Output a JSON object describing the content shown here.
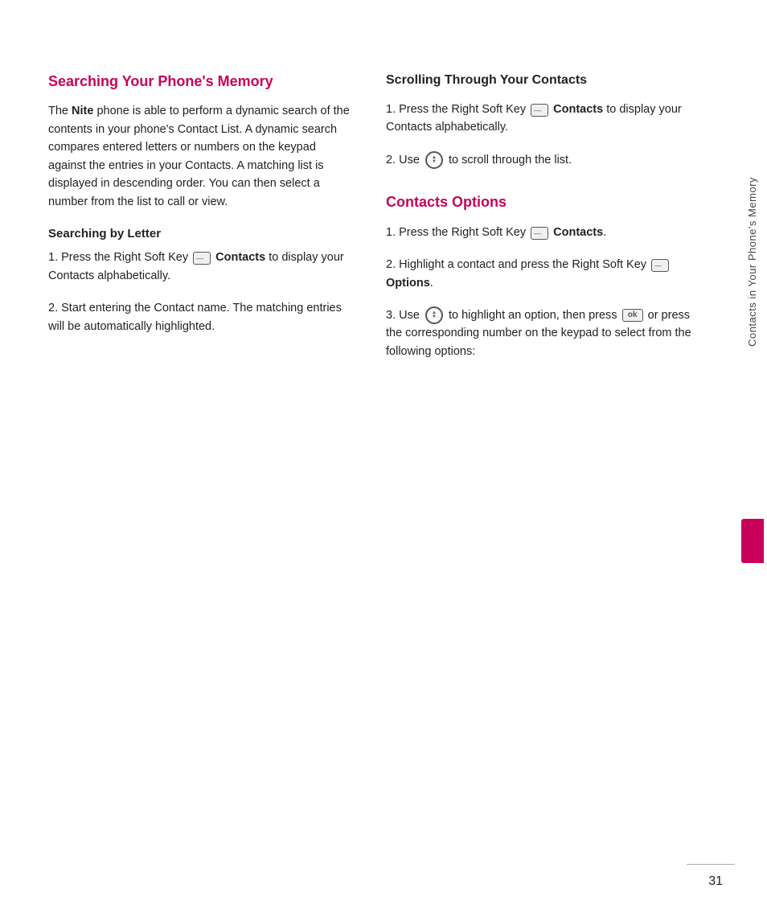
{
  "left_column": {
    "title": "Searching Your Phone's Memory",
    "intro": "The Nite phone is able to perform a dynamic search of the contents in your phone's Contact List. A dynamic search compares entered letters or numbers on the keypad against the entries in your Contacts. A matching list is displayed in descending order. You can then select a number from the list to call or view.",
    "intro_bold_word": "Nite",
    "sub_heading": "Searching by Letter",
    "items": [
      {
        "number": "1.",
        "text_before": "Press the Right Soft Key",
        "bold_word": "Contacts",
        "text_after": "to display your Contacts alphabetically.",
        "has_softkey_icon": true
      },
      {
        "number": "2.",
        "text": "Start entering the Contact name. The matching entries will be automatically highlighted."
      }
    ]
  },
  "right_column": {
    "scroll_section": {
      "title": "Scrolling Through Your Contacts",
      "items": [
        {
          "number": "1.",
          "text_before": "Press the Right Soft Key",
          "bold_word": "Contacts",
          "text_after": "to display your Contacts alphabetically.",
          "has_softkey_icon": true
        },
        {
          "number": "2.",
          "text_before": "Use",
          "text_after": "to scroll through the list.",
          "has_nav_icon": true
        }
      ]
    },
    "options_section": {
      "title": "Contacts Options",
      "items": [
        {
          "number": "1.",
          "text_before": "Press the Right Soft Key",
          "bold_word": "Contacts",
          "text_after": ".",
          "has_softkey_icon": true
        },
        {
          "number": "2.",
          "text_before": "Highlight a contact and press the Right Soft Key",
          "bold_word": "Options",
          "text_after": ".",
          "has_softkey_icon": true
        },
        {
          "number": "3.",
          "text_before": "Use",
          "text_middle1": "to highlight an option, then press",
          "text_middle2": "or press the corresponding number on the keypad to select from the following options:",
          "has_nav_icon": true,
          "has_ok_icon": true
        }
      ]
    }
  },
  "sidebar": {
    "text": "Contacts in Your Phone's Memory"
  },
  "page_number": "31"
}
